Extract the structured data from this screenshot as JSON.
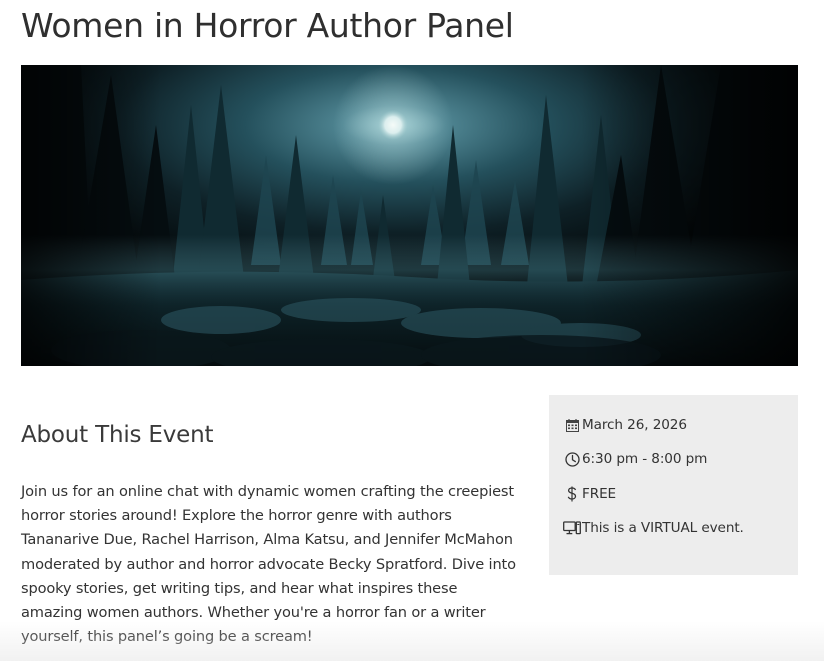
{
  "event": {
    "title": "Women in Horror Author Panel",
    "image_alt": "Moonlit dark forest",
    "about_heading": "About This Event",
    "description": "Join us for an online chat with dynamic women crafting the creepiest horror stories around! Explore the horror genre with authors Tananarive Due, Rachel Harrison, Alma Katsu, and Jennifer McMahon moderated by author and horror advocate Becky Spratford. Dive into spooky stories, get writing tips, and hear what inspires these amazing women authors. Whether you're a horror fan or a writer yourself, this panel’s going be a scream!"
  },
  "details": {
    "date": {
      "icon": "calendar-icon",
      "text": "March 26, 2026"
    },
    "time": {
      "icon": "clock-icon",
      "text": "6:30 pm - 8:00 pm"
    },
    "cost": {
      "icon": "dollar-icon",
      "text": "FREE"
    },
    "type": {
      "icon": "computer-icon",
      "text": "This is a VIRTUAL event."
    }
  },
  "colors": {
    "title_text": "#2f2f2f",
    "body_text": "#333333",
    "details_background": "#ededed",
    "image_tint": "#1b3a44"
  }
}
